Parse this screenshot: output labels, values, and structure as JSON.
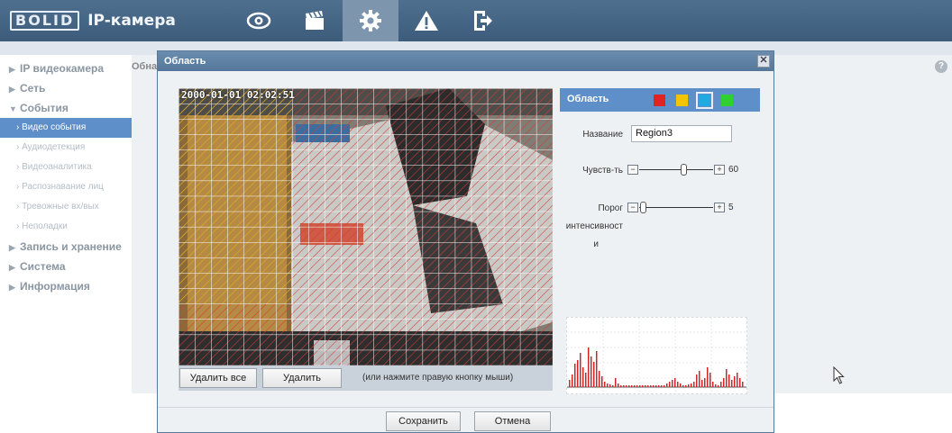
{
  "header": {
    "logo_text": "BOLID",
    "title": "IP-камера",
    "nav_icons": [
      "eye-icon",
      "clapperboard-icon",
      "gear-icon",
      "warning-icon",
      "exit-icon"
    ],
    "active_nav": "gear-icon"
  },
  "sidebar": {
    "groups": [
      {
        "label": "IP видеокамера"
      },
      {
        "label": "Сеть"
      },
      {
        "label": "События",
        "expanded": true,
        "items": [
          "Видео события",
          "Аудиодетекция",
          "Видеоаналитика",
          "Распознавание лиц",
          "Тревожные вх/вых",
          "Неполадки"
        ],
        "active_item": "Видео события"
      },
      {
        "label": "Запись и хранение"
      },
      {
        "label": "Система"
      },
      {
        "label": "Информация"
      }
    ]
  },
  "content": {
    "title_fragment": "Обна"
  },
  "dialog": {
    "title": "Область",
    "close_label": "✕",
    "video": {
      "timestamp": "2000-01-01 02:02:51"
    },
    "toolbar": {
      "delete_all": "Удалить все",
      "delete": "Удалить",
      "hint": "(или нажмите правую кнопку мыши)"
    },
    "panel": {
      "region_label": "Область",
      "swatches": [
        "#e02424",
        "#f5c400",
        "#21a9e1",
        "#2fd02f"
      ],
      "selected_swatch": 2,
      "name_label": "Название",
      "name_value": "Region3",
      "sensitivity": {
        "label": "Чувств-ть",
        "value": "60",
        "fraction": 0.6
      },
      "threshold": {
        "label_line1": "Порог",
        "label_line2": "интенсивност",
        "label_line3": "и",
        "value": "5",
        "fraction": 0.05
      }
    },
    "footer": {
      "save": "Сохранить",
      "cancel": "Отмена"
    }
  },
  "colors": {
    "header_bg": "#3d5c7c",
    "accent": "#5f8fc8",
    "grid": "#ffffff",
    "region_hatch": "#d63a3a",
    "region_yellow": "#d8c020"
  }
}
